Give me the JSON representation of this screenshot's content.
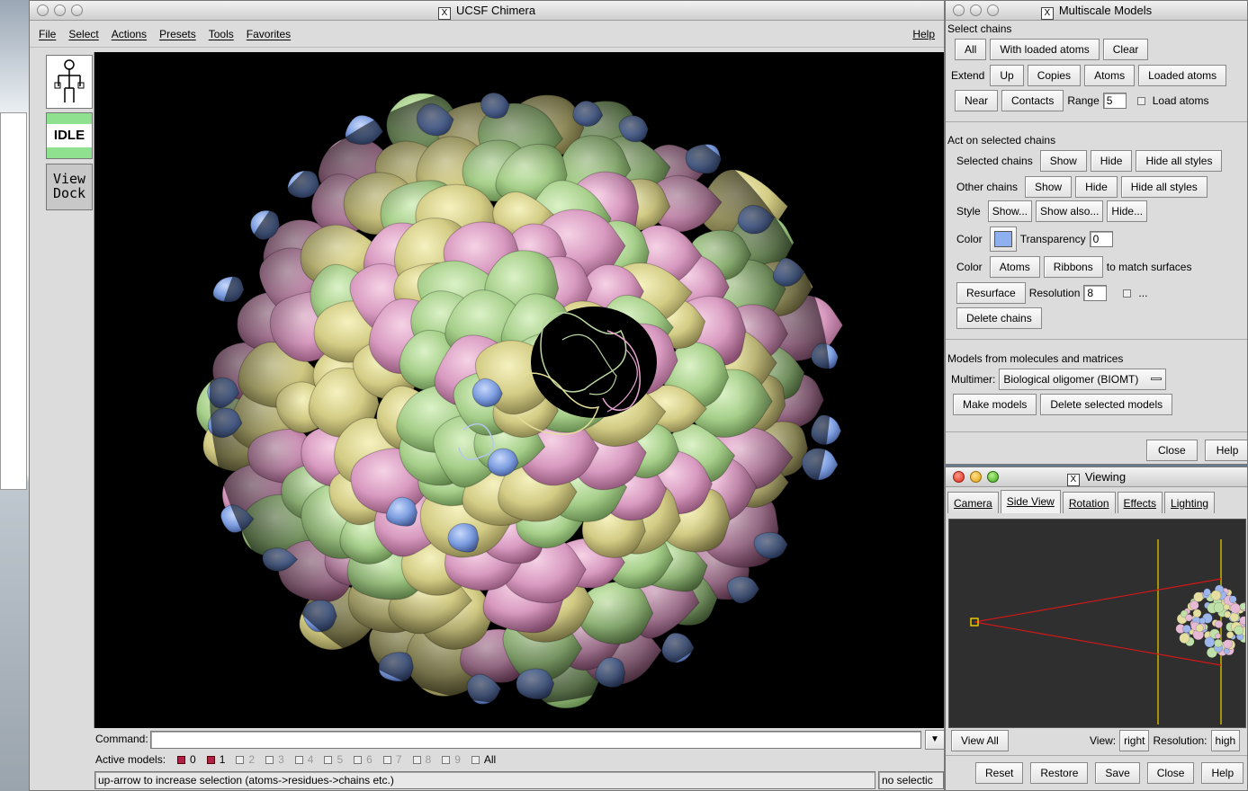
{
  "chimera": {
    "title": "UCSF Chimera",
    "menus": [
      "File",
      "Select",
      "Actions",
      "Presets",
      "Tools",
      "Favorites"
    ],
    "help": "Help",
    "toolbar": {
      "idle": "IDLE",
      "view_dock_line1": "View",
      "view_dock_line2": "Dock"
    },
    "command_label": "Command:",
    "command_value": "",
    "active_models_label": "Active models:",
    "models": [
      {
        "label": "0",
        "active": true
      },
      {
        "label": "1",
        "active": true
      },
      {
        "label": "2",
        "active": false
      },
      {
        "label": "3",
        "active": false
      },
      {
        "label": "4",
        "active": false
      },
      {
        "label": "5",
        "active": false
      },
      {
        "label": "6",
        "active": false
      },
      {
        "label": "7",
        "active": false
      },
      {
        "label": "8",
        "active": false
      },
      {
        "label": "9",
        "active": false
      }
    ],
    "all_label": "All",
    "status_text": "up-arrow to increase selection (atoms->residues->chains etc.)",
    "selection_status": "no selectic",
    "surface_colors": {
      "pink": "#d8a0c0",
      "green": "#a8d08c",
      "yellow": "#d6cf8a",
      "blue": "#7f9fe0",
      "background": "#000000"
    }
  },
  "multiscale": {
    "title": "Multiscale Models",
    "select_chains_heading": "Select chains",
    "all": "All",
    "with_loaded_atoms": "With loaded atoms",
    "clear": "Clear",
    "extend_label": "Extend",
    "up": "Up",
    "copies": "Copies",
    "atoms": "Atoms",
    "loaded_atoms": "Loaded atoms",
    "near": "Near",
    "contacts": "Contacts",
    "range_label": "Range",
    "range_value": "5",
    "load_atoms": "Load atoms",
    "act_heading": "Act on selected chains",
    "selected_chains_label": "Selected chains",
    "show": "Show",
    "hide": "Hide",
    "hide_all_styles": "Hide all styles",
    "other_chains_label": "Other chains",
    "style_label": "Style",
    "style_show": "Show...",
    "style_show_also": "Show also...",
    "style_hide": "Hide...",
    "color_label": "Color",
    "color_swatch": "#8fb0f0",
    "transparency_label": "Transparency",
    "transparency_value": "0",
    "color_atoms": "Atoms",
    "color_ribbons": "Ribbons",
    "to_match_surfaces": "to match surfaces",
    "resurface": "Resurface",
    "resolution_label": "Resolution",
    "resolution_value": "8",
    "ellipsis": "...",
    "delete_chains": "Delete chains",
    "models_heading": "Models from molecules and matrices",
    "multimer_label": "Multimer:",
    "multimer_value": "Biological oligomer (BIOMT)",
    "make_models": "Make models",
    "delete_selected_models": "Delete selected models",
    "close": "Close",
    "help": "Help"
  },
  "viewing": {
    "title": "Viewing",
    "tabs": [
      "Camera",
      "Side View",
      "Rotation",
      "Effects",
      "Lighting"
    ],
    "active_tab": "Side View",
    "view_all": "View All",
    "view_label": "View:",
    "view_value": "right",
    "resolution_label": "Resolution:",
    "resolution_value": "high",
    "reset": "Reset",
    "restore": "Restore",
    "save": "Save",
    "close": "Close",
    "help": "Help"
  }
}
